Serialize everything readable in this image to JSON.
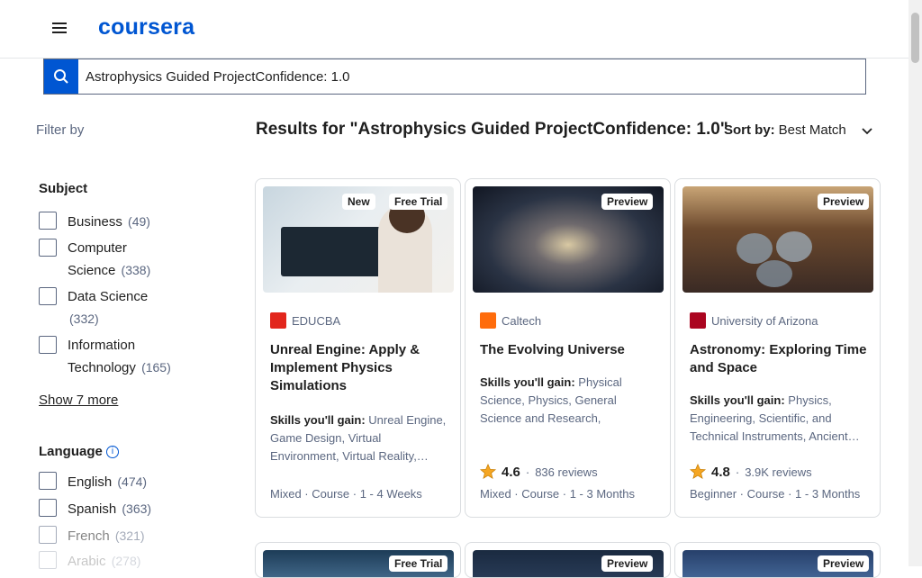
{
  "header": {
    "logo": "coursera",
    "menu_icon": "hamburger-icon"
  },
  "search": {
    "value": "Astrophysics Guided ProjectConfidence: 1.0",
    "button_icon": "search-icon"
  },
  "filters": {
    "filter_by": "Filter by",
    "subject": {
      "title": "Subject",
      "items": [
        {
          "label": "Business",
          "count": "(49)"
        },
        {
          "label": "Computer Science",
          "count": "(338)"
        },
        {
          "label": "Data Science",
          "count": "(332)"
        },
        {
          "label": "Information Technology",
          "count": "(165)"
        }
      ],
      "show_more": "Show 7 more"
    },
    "language": {
      "title": "Language",
      "items": [
        {
          "label": "English",
          "count": "(474)"
        },
        {
          "label": "Spanish",
          "count": "(363)"
        },
        {
          "label": "French",
          "count": "(321)"
        },
        {
          "label": "Arabic",
          "count": "(278)"
        }
      ]
    }
  },
  "results": {
    "title": "Results for \"Astrophysics Guided ProjectConfidence: 1.0\"",
    "sort_label": "Sort by:",
    "sort_value": "Best Match"
  },
  "cards": [
    {
      "badges": [
        "New",
        "Free Trial"
      ],
      "partner": "EDUCBA",
      "title": "Unreal Engine: Apply & Implement Physics Simulations",
      "skills_label": "Skills you'll gain:",
      "skills": "Unreal Engine, Game Design, Virtual Environment, Virtual Reality,…",
      "rating": "",
      "reviews": "",
      "meta": "Mixed · Course · 1 - 4 Weeks",
      "colors": {
        "img_bg": "#dfe6ea",
        "logo": "#e2261c"
      }
    },
    {
      "badges": [
        "Preview"
      ],
      "partner": "Caltech",
      "title": "The Evolving Universe",
      "skills_label": "Skills you'll gain:",
      "skills": "Physical Science, Physics, General Science and Research, Mechanics, Spati…",
      "rating": "4.6",
      "reviews": "836 reviews",
      "meta": "Mixed · Course · 1 - 3 Months",
      "colors": {
        "img_bg": "#2a3344",
        "logo": "#ff6c0c"
      }
    },
    {
      "badges": [
        "Preview"
      ],
      "partner": "University of Arizona",
      "title": "Astronomy: Exploring Time and Space",
      "skills_label": "Skills you'll gain:",
      "skills": "Physics, Engineering, Scientific, and Technical Instruments, Ancient…",
      "rating": "4.8",
      "reviews": "3.9K reviews",
      "meta": "Beginner · Course · 1 - 3 Months",
      "colors": {
        "img_bg": "#6d4a2e",
        "logo": "#ab0520"
      }
    }
  ],
  "next_row_badges": [
    "Free Trial",
    "Preview",
    "Preview"
  ],
  "colors": {
    "brand": "#0056d2",
    "star": "#f5a623",
    "border": "#dadde0"
  }
}
